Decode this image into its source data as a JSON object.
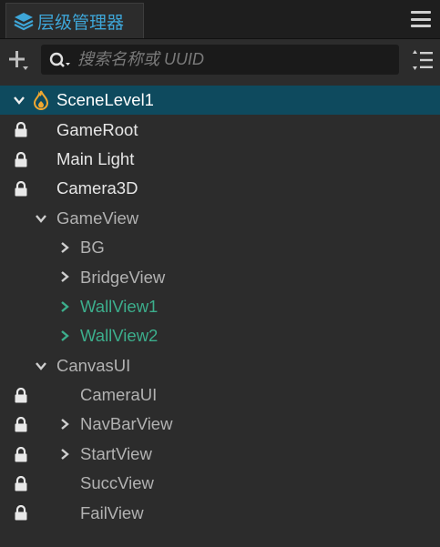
{
  "panel": {
    "title": "层级管理器",
    "accent_color": "#3ea6d8",
    "selected_bg": "#0e4a5e",
    "prefab_color": "#3cae8c"
  },
  "toolbar": {
    "search_placeholder": "搜索名称或 UUID"
  },
  "tree": {
    "nodes": [
      {
        "label": "SceneLevel1",
        "depth": 0,
        "expanded": true,
        "locked": false,
        "selected": true,
        "icon": "scene-icon"
      },
      {
        "label": "GameRoot",
        "depth": 1,
        "expanded": null,
        "locked": true
      },
      {
        "label": "Main Light",
        "depth": 1,
        "expanded": null,
        "locked": true
      },
      {
        "label": "Camera3D",
        "depth": 1,
        "expanded": null,
        "locked": true
      },
      {
        "label": "GameView",
        "depth": 1,
        "expanded": true,
        "locked": false
      },
      {
        "label": "BG",
        "depth": 2,
        "expanded": false,
        "locked": false
      },
      {
        "label": "BridgeView",
        "depth": 2,
        "expanded": false,
        "locked": false
      },
      {
        "label": "WallView1",
        "depth": 2,
        "expanded": false,
        "locked": false,
        "prefab": true
      },
      {
        "label": "WallView2",
        "depth": 2,
        "expanded": false,
        "locked": false,
        "prefab": true
      },
      {
        "label": "CanvasUI",
        "depth": 1,
        "expanded": true,
        "locked": false
      },
      {
        "label": "CameraUI",
        "depth": 2,
        "expanded": null,
        "locked": true
      },
      {
        "label": "NavBarView",
        "depth": 2,
        "expanded": false,
        "locked": true
      },
      {
        "label": "StartView",
        "depth": 2,
        "expanded": false,
        "locked": true
      },
      {
        "label": "SuccView",
        "depth": 2,
        "expanded": null,
        "locked": true
      },
      {
        "label": "FailView",
        "depth": 2,
        "expanded": null,
        "locked": true
      }
    ]
  }
}
